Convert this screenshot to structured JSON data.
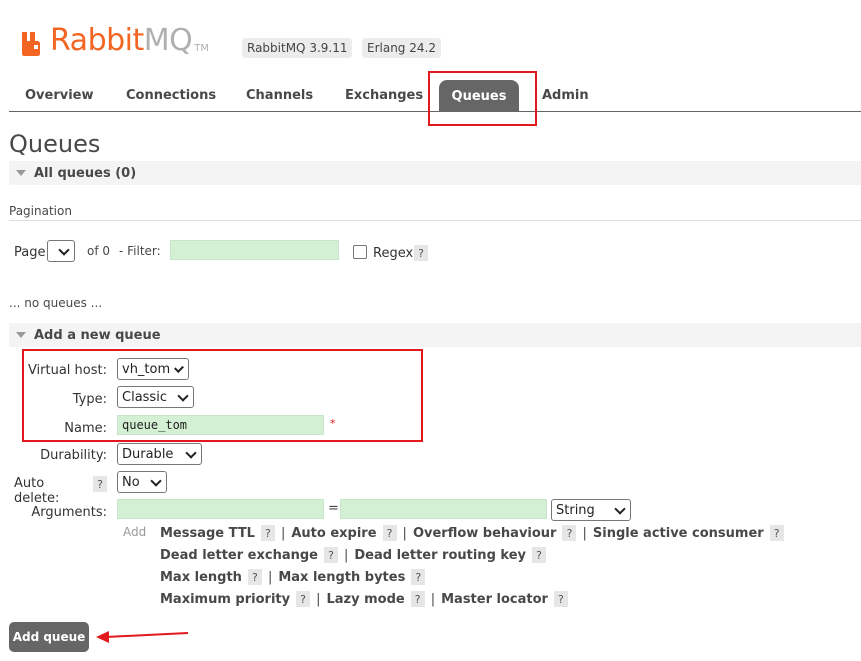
{
  "header": {
    "logo_rabbit": "Rabbit",
    "logo_mq": "MQ",
    "logo_tm": "TM",
    "version_badge": "RabbitMQ 3.9.11",
    "erlang_badge": "Erlang 24.2"
  },
  "nav": {
    "overview": "Overview",
    "connections": "Connections",
    "channels": "Channels",
    "exchanges": "Exchanges",
    "queues": "Queues",
    "admin": "Admin",
    "active": "Queues"
  },
  "page": {
    "title": "Queues",
    "all_queues": "All queues (0)",
    "pagination": "Pagination",
    "page_label": "Page",
    "of_label": "of 0",
    "filter_label": "- Filter:",
    "filter_value": "",
    "regex_label": "Regex",
    "help": "?",
    "no_queues": "... no queues ..."
  },
  "add_queue": {
    "section_title": "Add a new queue",
    "vhost_label": "Virtual host:",
    "vhost_value": "vh_tom",
    "type_label": "Type:",
    "type_value": "Classic",
    "name_label": "Name:",
    "name_value": "queue_tom",
    "required_mark": "*",
    "durability_label": "Durability:",
    "durability_value": "Durable",
    "auto_delete_label": "Auto delete:",
    "auto_delete_value": "No",
    "arguments_label": "Arguments:",
    "equals": "=",
    "arg_type_value": "String",
    "add_label": "Add",
    "args": {
      "message_ttl": "Message TTL",
      "auto_expire": "Auto expire",
      "overflow_behaviour": "Overflow behaviour",
      "single_active_consumer": "Single active consumer",
      "dead_letter_exchange": "Dead letter exchange",
      "dead_letter_routing_key": "Dead letter routing key",
      "max_length": "Max length",
      "max_length_bytes": "Max length bytes",
      "maximum_priority": "Maximum priority",
      "lazy_mode": "Lazy mode",
      "master_locator": "Master locator"
    },
    "separator": "|",
    "submit": "Add queue"
  },
  "colors": {
    "brand_orange": "#f26522",
    "annotation_red": "#e2191c",
    "input_green": "#d4f0d4",
    "active_tab": "#666666"
  }
}
